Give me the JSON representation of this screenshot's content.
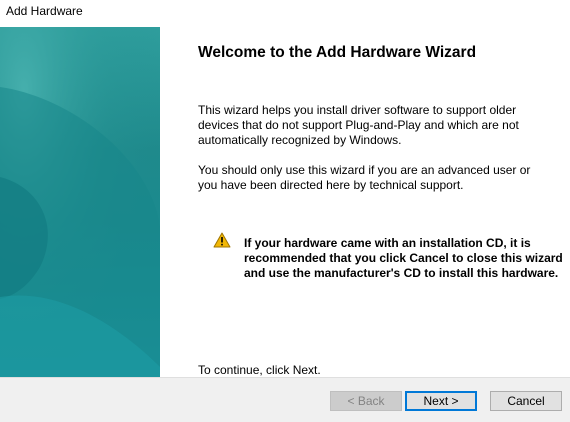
{
  "window": {
    "title": "Add Hardware"
  },
  "wizard": {
    "heading": "Welcome to the Add Hardware Wizard",
    "intro": "This wizard helps you install driver software to support older devices that do not support Plug-and-Play and which are not automatically recognized by Windows.",
    "advice": "You should only use this wizard if you are an advanced user or you have been directed here by technical support.",
    "warning": "If your hardware came with an installation CD, it is recommended that you click Cancel to close this wizard and use the manufacturer's CD to install this hardware.",
    "warning_icon": "warning-triangle-icon",
    "continue_text": "To continue, click Next."
  },
  "buttons": {
    "back": "< Back",
    "next": "Next >",
    "cancel": "Cancel"
  },
  "colors": {
    "side_panel": "#1f8a8c",
    "focus_border": "#0078d7",
    "warning_fill": "#f2b705"
  }
}
